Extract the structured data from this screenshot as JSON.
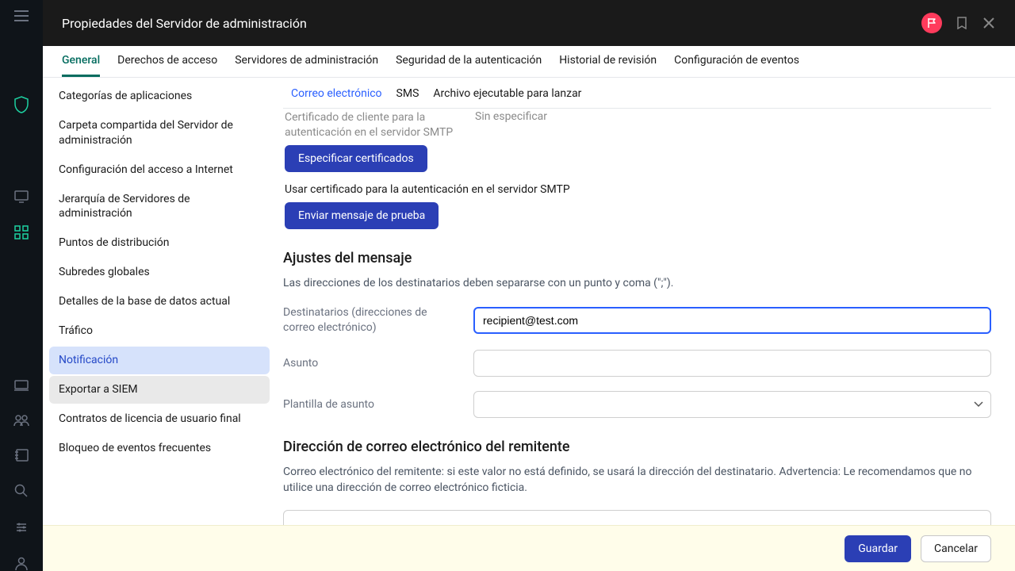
{
  "header": {
    "title": "Propiedades del Servidor de administración"
  },
  "tabs": {
    "general": "General",
    "access_rights": "Derechos de acceso",
    "admin_servers": "Servidores de administración",
    "auth_security": "Seguridad de la autenticación",
    "revision_history": "Historial de revisión",
    "event_config": "Configuración de eventos"
  },
  "sidebar": {
    "items": [
      "Categorías de aplicaciones",
      "Carpeta compartida del Servidor de administración",
      "Configuración del acceso a Internet",
      "Jerarquía de Servidores de administración",
      "Puntos de distribución",
      "Subredes globales",
      "Detalles de la base de datos actual",
      "Tráfico",
      "Notificación",
      "Exportar a SIEM",
      "Contratos de licencia de usuario final",
      "Bloqueo de eventos frecuentes"
    ]
  },
  "subtabs": {
    "email": "Correo electrónico",
    "sms": "SMS",
    "exec": "Archivo ejecutable para lanzar"
  },
  "cert": {
    "label": "Certificado de cliente para la autenticación en el servidor SMTP",
    "value": "Sin especificar",
    "specify_btn": "Especificar certificados",
    "use_cert_label": "Usar certificado para la autenticación en el servidor SMTP",
    "test_btn": "Enviar mensaje de prueba"
  },
  "message": {
    "heading": "Ajustes del mensaje",
    "help": "Las direcciones de los destinatarios deben separarse con un punto y coma (\";\").",
    "recipients_label": "Destinatarios (direcciones de correo electrónico)",
    "recipients_value": "recipient@test.com",
    "subject_label": "Asunto",
    "subject_value": "",
    "template_label": "Plantilla de asunto",
    "template_value": ""
  },
  "sender": {
    "heading": "Dirección de correo electrónico del remitente",
    "help": "Correo electrónico del remitente: si este valor no está definido, se usará la dirección del destinatario. Advertencia: Le recomendamos que no utilice una dirección de correo electrónico ficticia.",
    "value": ""
  },
  "footer": {
    "save": "Guardar",
    "cancel": "Cancelar"
  }
}
